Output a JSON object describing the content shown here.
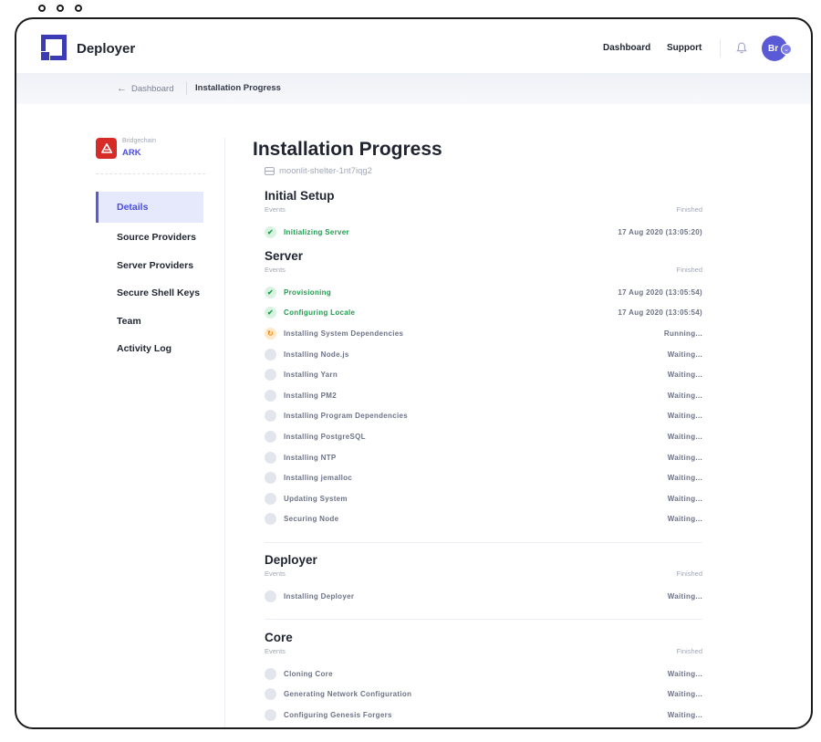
{
  "window": {
    "controls": [
      "close",
      "minimize",
      "maximize"
    ]
  },
  "header": {
    "brand": "Deployer",
    "nav": [
      "Dashboard",
      "Support"
    ],
    "avatar_initials": "Br",
    "accent_color": "#5b5ad6"
  },
  "breadcrumb": {
    "back": "Dashboard",
    "current": "Installation Progress"
  },
  "sidebar": {
    "project_type": "Bridgechain",
    "project_name": "ARK",
    "menu": [
      {
        "label": "Details",
        "active": true
      },
      {
        "label": "Source Providers",
        "active": false
      },
      {
        "label": "Server Providers",
        "active": false
      },
      {
        "label": "Secure Shell Keys",
        "active": false
      },
      {
        "label": "Team",
        "active": false
      },
      {
        "label": "Activity Log",
        "active": false
      }
    ]
  },
  "main": {
    "title": "Installation Progress",
    "server_name": "moonlit-shelter-1nt7iqg2",
    "sections": [
      {
        "title": "Initial Setup",
        "col_left": "Events",
        "col_right": "Finished",
        "events": [
          {
            "label": "Initializing Server",
            "state": "done",
            "status": "17 Aug 2020 (13:05:20)"
          }
        ]
      },
      {
        "title": "Server",
        "col_left": "Events",
        "col_right": "Finished",
        "events": [
          {
            "label": "Provisioning",
            "state": "done",
            "status": "17 Aug 2020 (13:05:54)"
          },
          {
            "label": "Configuring Locale",
            "state": "done",
            "status": "17 Aug 2020 (13:05:54)"
          },
          {
            "label": "Installing System Dependencies",
            "state": "running",
            "status": "Running..."
          },
          {
            "label": "Installing Node.js",
            "state": "waiting",
            "status": "Waiting..."
          },
          {
            "label": "Installing Yarn",
            "state": "waiting",
            "status": "Waiting..."
          },
          {
            "label": "Installing PM2",
            "state": "waiting",
            "status": "Waiting..."
          },
          {
            "label": "Installing Program Dependencies",
            "state": "waiting",
            "status": "Waiting..."
          },
          {
            "label": "Installing PostgreSQL",
            "state": "waiting",
            "status": "Waiting..."
          },
          {
            "label": "Installing NTP",
            "state": "waiting",
            "status": "Waiting..."
          },
          {
            "label": "Installing jemalloc",
            "state": "waiting",
            "status": "Waiting..."
          },
          {
            "label": "Updating System",
            "state": "waiting",
            "status": "Waiting..."
          },
          {
            "label": "Securing Node",
            "state": "waiting",
            "status": "Waiting..."
          }
        ]
      },
      {
        "title": "Deployer",
        "col_left": "Events",
        "col_right": "Finished",
        "events": [
          {
            "label": "Installing Deployer",
            "state": "waiting",
            "status": "Waiting..."
          }
        ]
      },
      {
        "title": "Core",
        "col_left": "Events",
        "col_right": "Finished",
        "events": [
          {
            "label": "Cloning Core",
            "state": "waiting",
            "status": "Waiting..."
          },
          {
            "label": "Generating Network Configuration",
            "state": "waiting",
            "status": "Waiting..."
          },
          {
            "label": "Configuring Genesis Forgers",
            "state": "waiting",
            "status": "Waiting..."
          }
        ]
      }
    ]
  },
  "colors": {
    "done": "#1f9d4e",
    "running": "#f08d1d",
    "waiting": "#e3e5ec",
    "project_logo": "#d72b28"
  }
}
